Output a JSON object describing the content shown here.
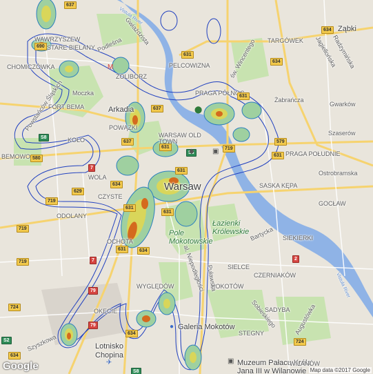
{
  "map": {
    "attribution": "Map data ©2017 Google",
    "logo": "Google",
    "colors": {
      "land": "#e9e5dc",
      "park": "#c8e3b0",
      "water": "#8fb3e6",
      "major_road": "#f6d36f",
      "road": "#ffffff",
      "contour_outer": "#1f3fbf",
      "contour_mid": "#2b7fbf",
      "fill_low": "#9fd0a0",
      "fill_mid": "#d9d65a",
      "fill_high": "#d46a1e"
    },
    "labels": {
      "warsaw": "Warsaw",
      "old_town": "WARSAW OLD TOWN",
      "arkadia": "Arkadia",
      "lazienki": "Łazienki Królewskie",
      "pole": "Pole Mokotowskie",
      "galeria": "Galeria Mokotów",
      "lotnisko": "Lotnisko Chopina",
      "muzeum": "Muzeum Pałacu Króla Jana III w Wilanowie",
      "zabki": "Ząbki",
      "wawrzyszew": "WAWRZYSZEW",
      "stare_bielany": "STARE BIELANY",
      "chomiczowka": "CHOMICZÓWKA",
      "fort_bema": "FORT BEMA",
      "kolo": "KOŁO",
      "bemowo": "BEMOWO",
      "wola": "WOLA",
      "czyste": "CZYSTE",
      "odolany": "ODOLANY",
      "ochota": "OCHOTA",
      "zoliborz": "ŻOLIBORZ",
      "powazki": "POWĄZKI",
      "pelcowizna": "PELCOWIZNA",
      "praga_polnoc": "PRAGA PÓŁNOC",
      "praga_poludnie": "PRAGA POŁUDNIE",
      "targowek": "TARGÓWEK",
      "saska_kepa": "SASKA KĘPA",
      "goclaw": "GOCŁAW",
      "siekierki": "SIEKIERKI",
      "sielce": "SIELCE",
      "czerniakow": "CZERNIAKÓW",
      "mokotow": "MOKOTÓW",
      "wyglendow": "WYGLĘDÓW",
      "okecie": "OKĘCIE",
      "sadyba": "SADYBA",
      "stegny": "STEGNY",
      "wilanow": "WILANÓW",
      "gwarkow": "Gwarków",
      "szaserow": "Szaserów",
      "ostrobramska": "Ostrobramska",
      "zabranczka": "Żabrańcza",
      "jagiellonska": "Jagiellońska",
      "radzyminska": "Radzymińska",
      "sw_wincentego": "św. Wincentego",
      "wisla1": "Vistula River",
      "wisla2": "Vistula River",
      "szyszkowa": "Szyszkowa",
      "powstancow": "Powstańców Śląskich",
      "mozka": "Moczka",
      "podlesna": "Podleśna",
      "gwiazdzista": "Gwiaździsta",
      "sobieskiego": "Sobieskiego",
      "augustowka": "Augustówka",
      "niepodleglosci": "al. Niepodległości",
      "pulawska": "Puławska",
      "bp": "Bartycka"
    },
    "shields": [
      "637",
      "690",
      "634",
      "631",
      "637",
      "634",
      "631",
      "580",
      "S8",
      "629",
      "719",
      "719",
      "719",
      "7",
      "7",
      "79",
      "631",
      "724",
      "S2",
      "S8",
      "637",
      "719",
      "631",
      "634",
      "634",
      "S8",
      "579",
      "631",
      "631",
      "2",
      "631",
      "634",
      "634",
      "631",
      "724",
      "79"
    ],
    "roads_list": [
      "Zabki-634",
      "637"
    ]
  },
  "heatmap_regions": [
    {
      "name": "Wawrzyszew hotspot",
      "intensity": "high"
    },
    {
      "name": "Arkadia hotspot",
      "intensity": "high"
    },
    {
      "name": "Centrum hotspot",
      "intensity": "high"
    },
    {
      "name": "Ochota hotspot",
      "intensity": "high"
    },
    {
      "name": "Praga Północ hotspot",
      "intensity": "high"
    },
    {
      "name": "Okęcie hotspot",
      "intensity": "high"
    },
    {
      "name": "Galeria Mokotów hotspot",
      "intensity": "medium"
    },
    {
      "name": "Wilanów hotspot",
      "intensity": "medium"
    }
  ]
}
